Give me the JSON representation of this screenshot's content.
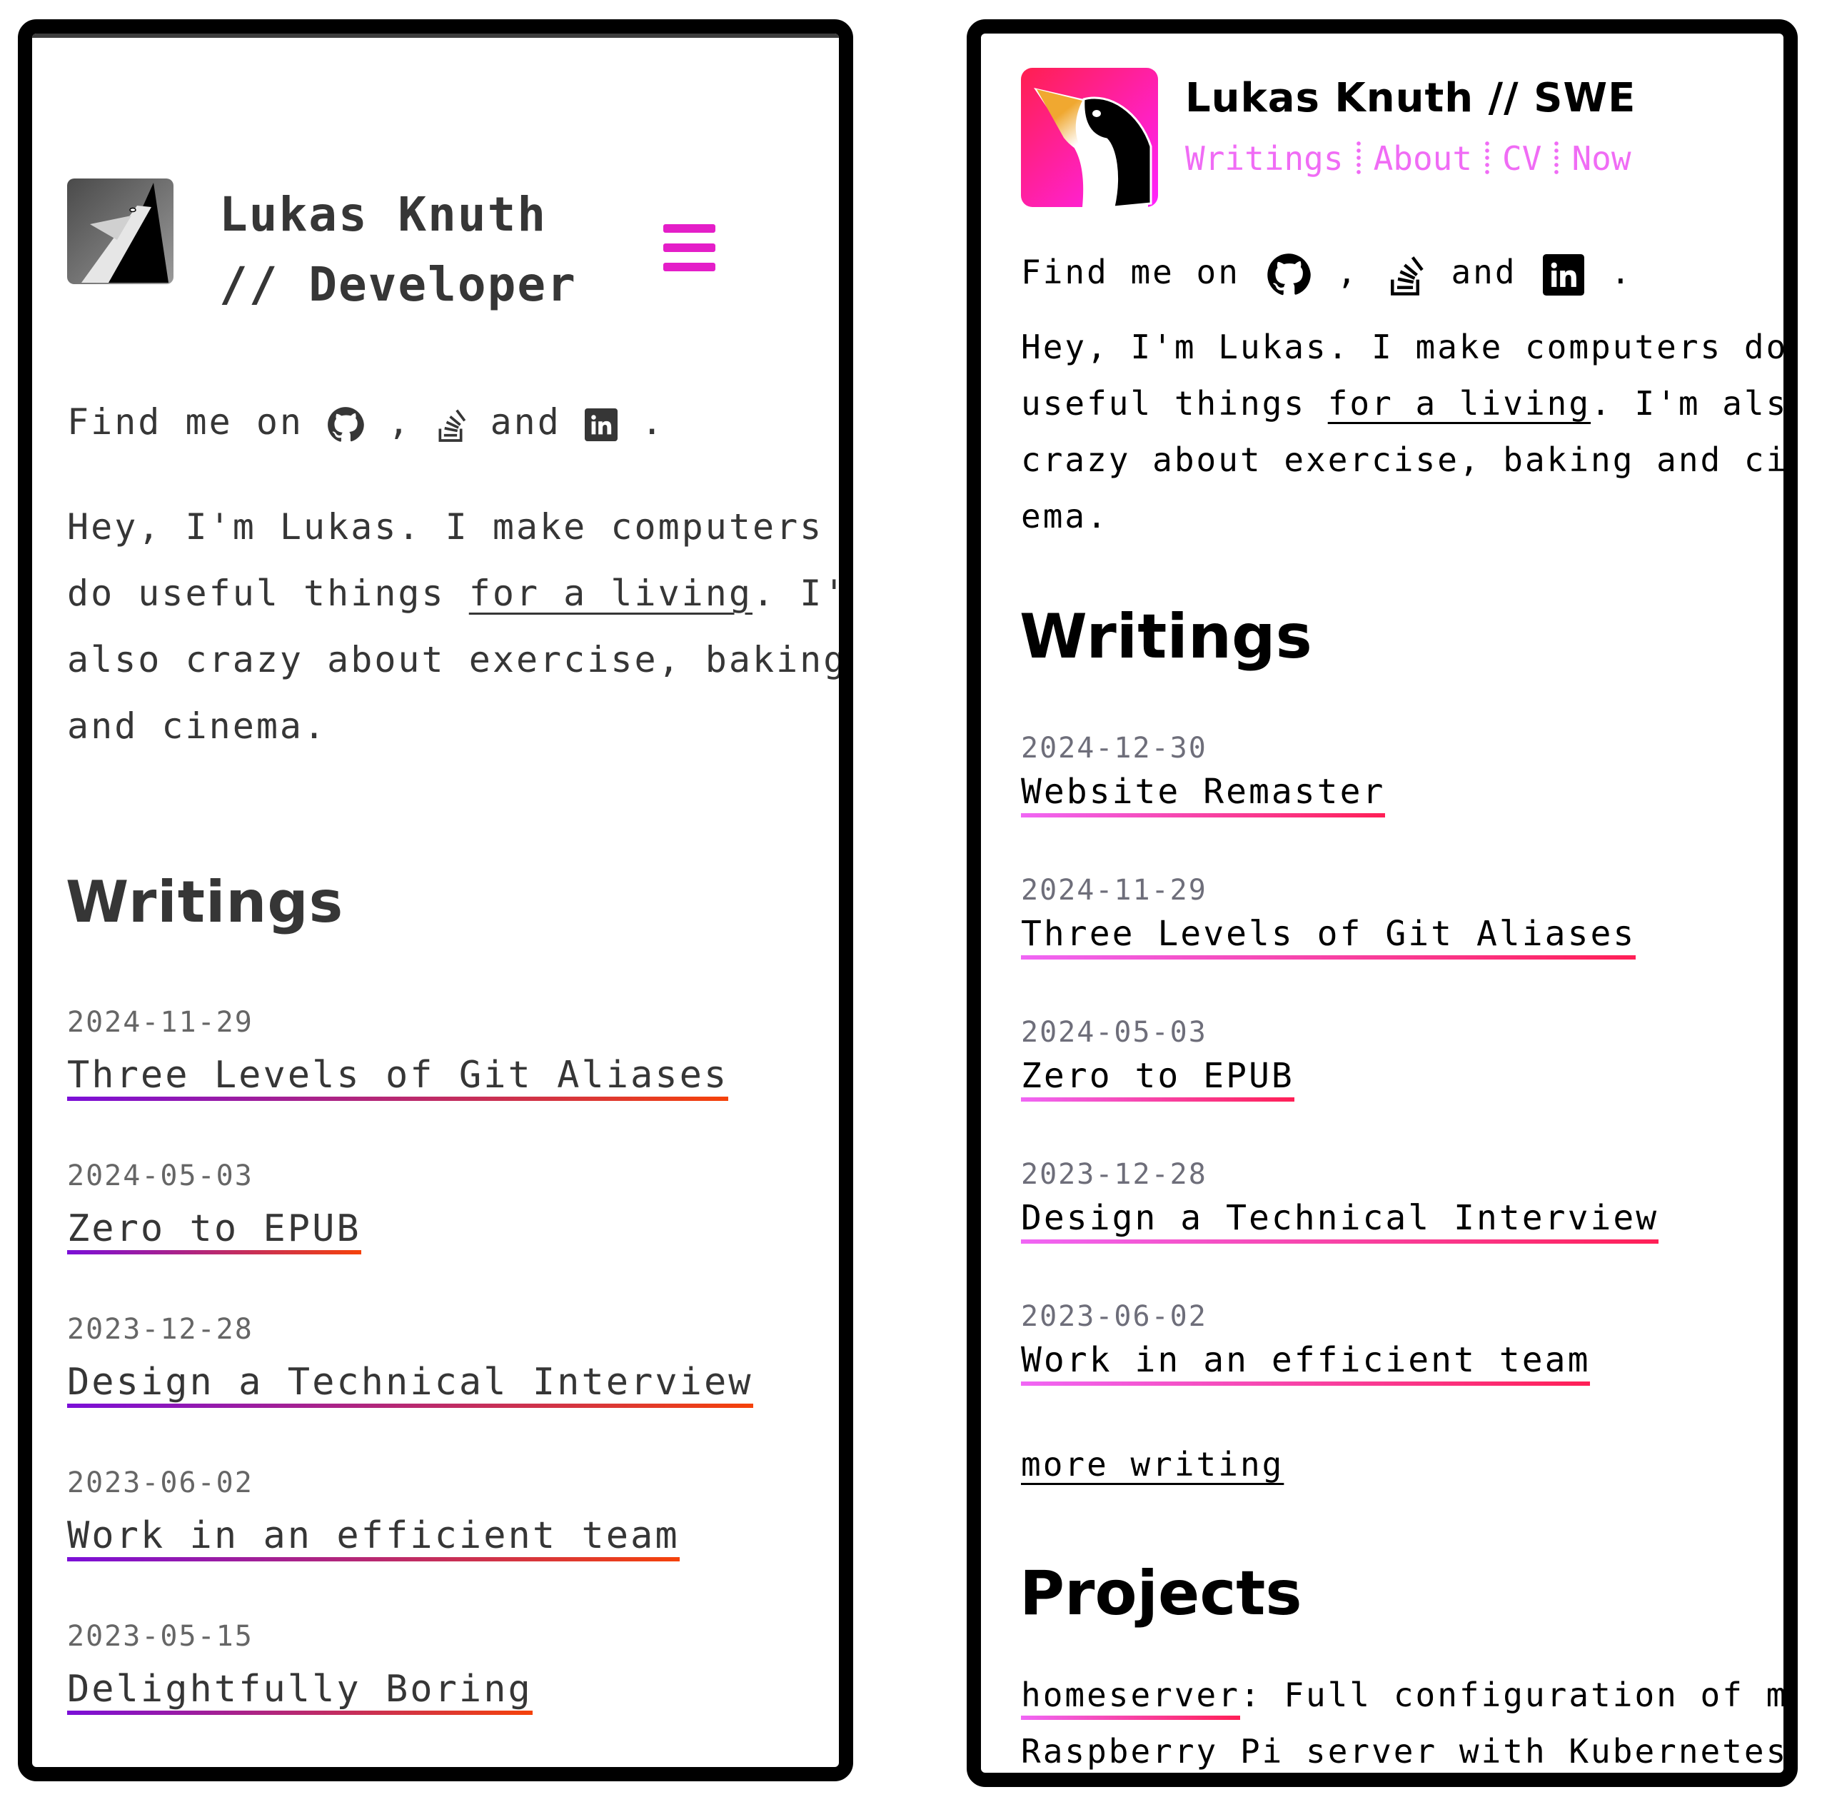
{
  "left": {
    "title_line1": "Lukas Knuth",
    "title_line2": "// Developer",
    "menu_icon": "hamburger-menu-icon",
    "menu_color": "#e41ec8",
    "find_me": {
      "prefix": "Find me on",
      "comma": ",",
      "and": "and",
      "period": ".",
      "icons": [
        "github-icon",
        "stackoverflow-icon",
        "linkedin-icon"
      ]
    },
    "intro": {
      "before_link": "Hey, I'm Lukas. I make computers do useful things ",
      "link": "for a living",
      "after_link": ". I'm also crazy about exercise, baking and cinema.",
      "lines": [
        "Hey, I'm Lukas. I make computers",
        "do useful things ",
        ". I'm",
        "also crazy about exercise, baking",
        "and cinema."
      ]
    },
    "writings_heading": "Writings",
    "writings": [
      {
        "date": "2024-11-29",
        "title": "Three Levels of Git Aliases"
      },
      {
        "date": "2024-05-03",
        "title": "Zero to EPUB"
      },
      {
        "date": "2023-12-28",
        "title": "Design a Technical Interview"
      },
      {
        "date": "2023-06-02",
        "title": "Work in an efficient team"
      },
      {
        "date": "2023-05-15",
        "title": "Delightfully Boring"
      }
    ],
    "accent_gradient": [
      "#7b0fd8",
      "#f5420a"
    ]
  },
  "right": {
    "title": "Lukas Knuth // SWE",
    "nav": [
      "Writings",
      "About",
      "CV",
      "Now"
    ],
    "nav_color": "#f06cf5",
    "find_me": {
      "prefix": "Find me on",
      "comma": ",",
      "and": "and",
      "period": ".",
      "icons": [
        "github-icon",
        "stackoverflow-icon",
        "linkedin-icon"
      ]
    },
    "intro": {
      "line1": "Hey, I'm Lukas. I make computers do",
      "line2_before": "useful things ",
      "link": "for a living",
      "line2_after": ". I'm also",
      "line3": "crazy about exercise, baking and cin-",
      "line4": "ema."
    },
    "writings_heading": "Writings",
    "writings": [
      {
        "date": "2024-12-30",
        "title": "Website Remaster"
      },
      {
        "date": "2024-11-29",
        "title": "Three Levels of Git Aliases"
      },
      {
        "date": "2024-05-03",
        "title": "Zero to EPUB"
      },
      {
        "date": "2023-12-28",
        "title": "Design a Technical Interview"
      },
      {
        "date": "2023-06-02",
        "title": "Work in an efficient team"
      }
    ],
    "more_writing": "more writing",
    "projects_heading": "Projects",
    "projects": [
      {
        "name": "homeserver",
        "separator": ":",
        "description_line1": " Full configuration of my",
        "description_line2": "Raspberry Pi server with Kubernetes via"
      }
    ],
    "accent_gradient": [
      "#f066f5",
      "#ff1f56"
    ]
  }
}
